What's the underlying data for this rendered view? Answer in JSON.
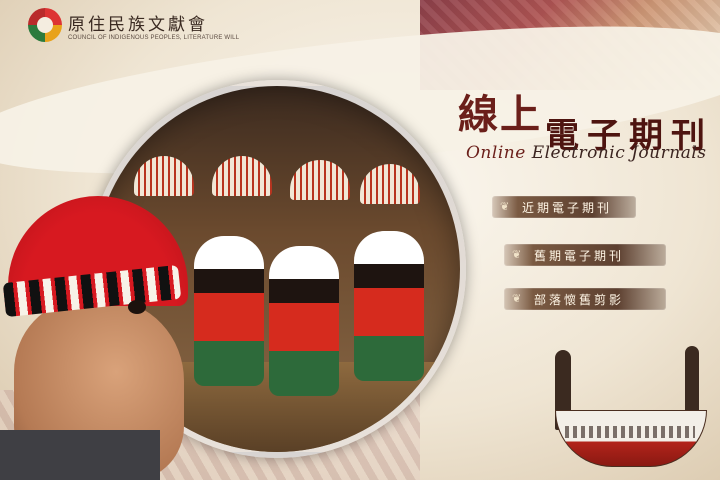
{
  "logo": {
    "name_zh": "原住民族文獻會",
    "name_en": "COUNCIL OF INDIGENOUS PEOPLES, LITERATURE WILL"
  },
  "title": {
    "line1": "線上",
    "line2": "電子期刊",
    "english_em": "Online",
    "english_rest": "Electronic Journals"
  },
  "menu": {
    "items": [
      {
        "label": "近期電子期刊",
        "icon": "ornament-icon"
      },
      {
        "label": "舊期電子期刊",
        "icon": "ornament-icon"
      },
      {
        "label": "部落懷舊剪影",
        "icon": "ornament-icon"
      }
    ]
  },
  "colors": {
    "title": "#6b1f1a",
    "menu_bg": "#5d4030",
    "menu_text": "#fff6e6"
  }
}
